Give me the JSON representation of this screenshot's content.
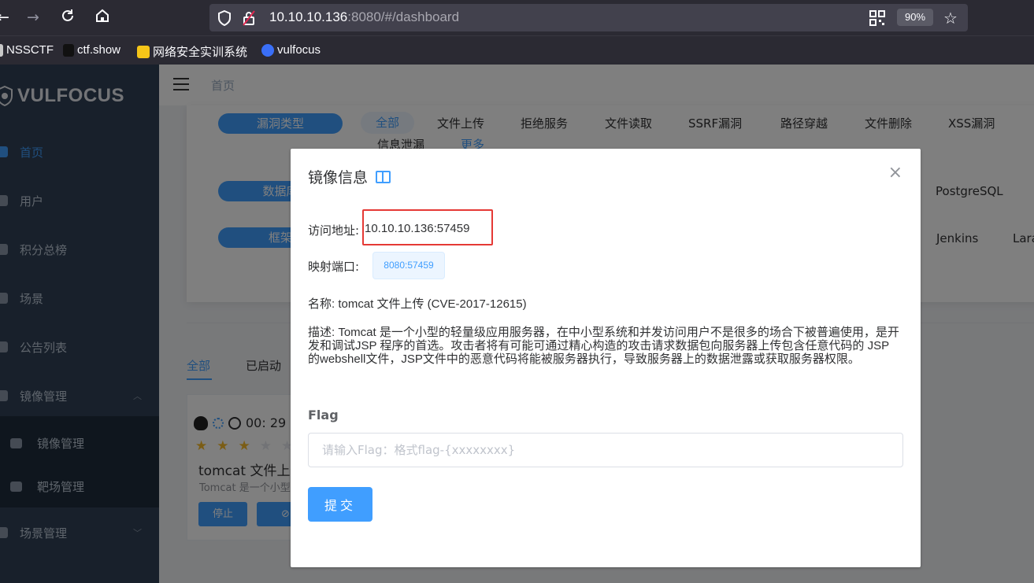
{
  "browser": {
    "url_host": "10.10.10.136",
    "url_rest": ":8080/#/dashboard",
    "zoom": "90%",
    "bookmarks": [
      "NSSCTF",
      "ctf.show",
      "网络安全实训系统",
      "vulfocus"
    ]
  },
  "sidebar": {
    "logo": "VULFOCUS",
    "items": [
      {
        "label": "首页"
      },
      {
        "label": "用户"
      },
      {
        "label": "积分总榜"
      },
      {
        "label": "场景"
      },
      {
        "label": "公告列表"
      },
      {
        "label": "镜像管理"
      },
      {
        "label": "场景管理"
      }
    ],
    "sub_items": [
      {
        "label": "镜像管理"
      },
      {
        "label": "靶场管理"
      }
    ]
  },
  "navbar": {
    "breadcrumb": "首页"
  },
  "filters": {
    "row1_pill": "漏洞类型",
    "row2_pill": "数据库",
    "row3_pill": "框架",
    "vuln_types": [
      "全部",
      "文件上传",
      "拒绝服务",
      "文件读取",
      "SSRF漏洞",
      "路径穿越",
      "文件删除",
      "XSS漏洞"
    ],
    "vuln_types_row2": [
      "信息泄漏",
      "更多"
    ],
    "db_tag": "PostgreSQL",
    "fw_tags": [
      "Jenkins",
      "Lara"
    ]
  },
  "tabs": [
    "全部",
    "已启动"
  ],
  "vuln_card": {
    "timer": "00: 29",
    "stars": "★★★★★",
    "title": "tomcat 文件上传",
    "desc": "Tomcat 是一个小型",
    "stop_label": "停止",
    "delete_label": "⊘ 删"
  },
  "dialog": {
    "title": "镜像信息",
    "addr_label": "访问地址:",
    "addr_value": "10.10.10.136:57459",
    "port_label": "映射端口:",
    "port_value": "8080:57459",
    "name_line": "名称: tomcat 文件上传 (CVE-2017-12615)",
    "description": "描述: Tomcat 是一个小型的轻量级应用服务器，在中小型系统和并发访问用户不是很多的场合下被普遍使用，是开发和调试JSP 程序的首选。攻击者将有可能可通过精心构造的攻击请求数据包向服务器上传包含任意代码的 JSP 的webshell文件，JSP文件中的恶意代码将能被服务器执行，导致服务器上的数据泄露或获取服务器权限。",
    "flag_label": "Flag",
    "flag_placeholder": "请输入Flag：格式flag-{xxxxxxxx}",
    "flag_value": "",
    "submit_label": "提交",
    "close_glyph": "×"
  },
  "colors": {
    "primary": "#409eff",
    "sidebar_bg": "#304156",
    "highlight": "#e53935"
  }
}
